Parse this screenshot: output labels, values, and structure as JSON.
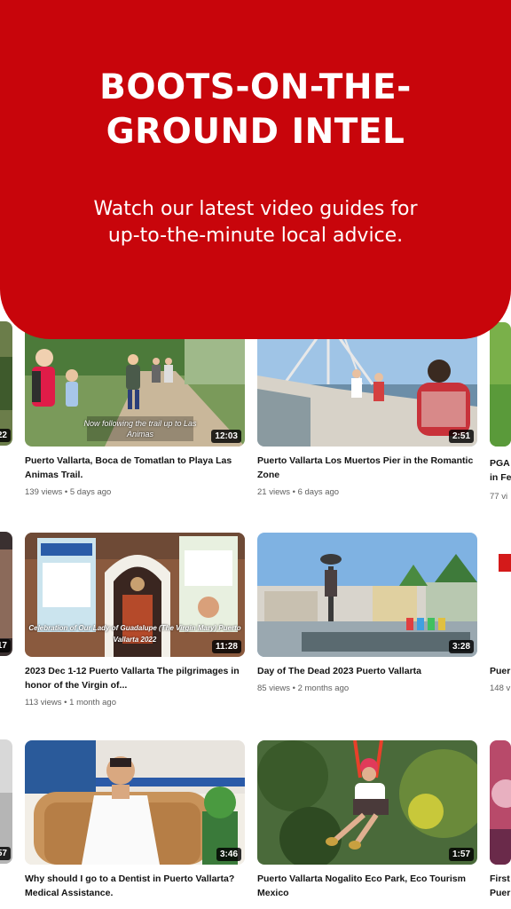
{
  "hero": {
    "title_line1": "BOOTS-ON-THE-",
    "title_line2": "GROUND INTEL",
    "subtitle": "Watch our latest video guides for up-to-the-minute local advice."
  },
  "videos": [
    {
      "title": "Puerto Vallarta, Boca de Tomatlan to Playa Las Animas Trail.",
      "views": "139 views",
      "age": "5 days ago",
      "duration": "12:03",
      "overlay": "Now following the trail up to Las Animas"
    },
    {
      "title": "Puerto Vallarta Los Muertos Pier in the Romantic Zone",
      "views": "21 views",
      "age": "6 days ago",
      "duration": "2:51"
    },
    {
      "title": "2023 Dec 1-12 Puerto Vallarta The pilgrimages in honor of the Virgin of...",
      "views": "113 views",
      "age": "1 month ago",
      "duration": "11:28",
      "overlay": "Celebration of Our Lady of Guadalupe (The Virgin Mary) Puerto Vallarta 2022"
    },
    {
      "title": "Day of The Dead 2023 Puerto Vallarta",
      "views": "85 views",
      "age": "2 months ago",
      "duration": "3:28"
    },
    {
      "title": "Why should I go to a Dentist in Puerto Vallarta? Medical Assistance.",
      "duration": "3:46"
    },
    {
      "title": "Puerto Vallarta Nogalito Eco Park, Eco Tourism Mexico",
      "duration": "1:57"
    }
  ],
  "edge_left": {
    "dur1": "22",
    "dur2": "17",
    "dur3": "57"
  },
  "edge_right": {
    "title1a": "PGA",
    "title1b": "in Fe",
    "meta1": "77 vi",
    "title2": "Puer",
    "meta2": "148 v",
    "title3a": "First",
    "title3b": "Puer"
  },
  "sep": " • "
}
